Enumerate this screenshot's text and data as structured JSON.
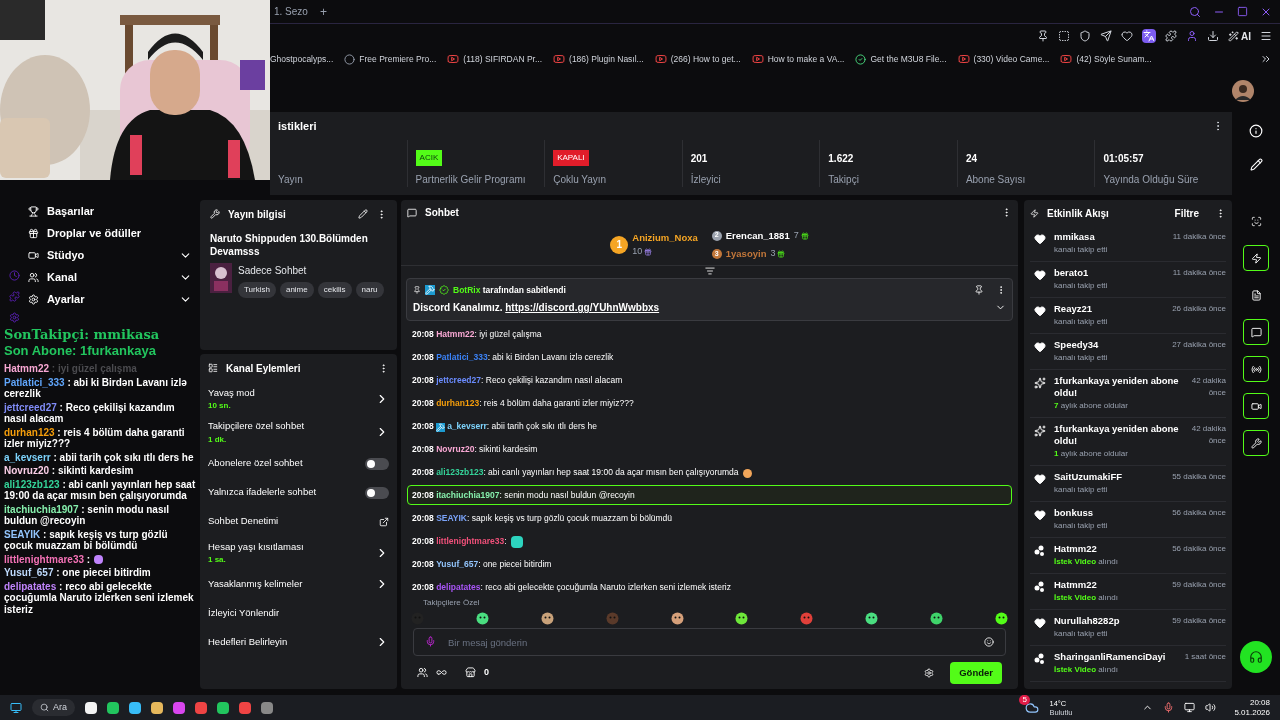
{
  "browser": {
    "tab": "1. Sezo",
    "new_tab": "+",
    "bookmarks": [
      "Ghostpocalyps...",
      "Free Premiere Pro...",
      "(118) SIFIRDAN Pr...",
      "(186) Plugin Nasıl...",
      "(266) How to get...",
      "How to make a VA...",
      "Get the M3U8 File...",
      "(330) Video Came...",
      "(42) Söyle Sunam..."
    ],
    "ai_label": "AI"
  },
  "stats": {
    "title": "istikleri",
    "cells": [
      {
        "label": "Yayın"
      },
      {
        "badge": "ACIK",
        "on": true,
        "label": "Partnerlik Gelir Programı"
      },
      {
        "badge": "KAPALI",
        "on": false,
        "label": "Çoklu Yayın"
      },
      {
        "value": "201",
        "label": "İzleyici"
      },
      {
        "value": "1.622",
        "label": "Takipçi"
      },
      {
        "value": "24",
        "label": "Abone Sayısı"
      },
      {
        "value": "01:05:57",
        "label": "Yayında Olduğu Süre"
      }
    ]
  },
  "sidebar": {
    "items": [
      {
        "label": "Başarılar"
      },
      {
        "label": "Droplar ve ödüller"
      },
      {
        "label": "Stüdyo",
        "expanded": false
      },
      {
        "label": "Kanal",
        "expanded": false
      },
      {
        "label": "Ayarlar",
        "expanded": false
      }
    ]
  },
  "overlay": {
    "last_follower": "SonTakipçi: mmikasa",
    "last_sub": "Son Abone: 1furkankaya",
    "chat": [
      {
        "kind": "text",
        "user": "Hatmm22",
        "color": "#f9a8d4",
        "text": " : iyi güzel çalışma",
        "faded": true
      },
      {
        "kind": "text",
        "user": "Patlatici_333",
        "color": "#60a5fa",
        "text": " : abi ki Birdən Lavanı izlə cerezlik",
        "faded": false
      },
      {
        "kind": "text",
        "user": "jettcreed27",
        "color": "#818cf8",
        "text": " : Reco çekilişi kazandım nasıl alacam",
        "faded": false
      },
      {
        "kind": "text",
        "user": "durhan123",
        "color": "#f59e0b",
        "text": " : reis 4 bölüm daha garanti izler miyiz???",
        "faded": false
      },
      {
        "kind": "text",
        "user": "a_kevserr",
        "color": "#7dd3fc",
        "text": " : abii tarih çok sıkı ıtlı ders he",
        "faded": false
      },
      {
        "kind": "text",
        "user": "Novruz20",
        "color": "#fbcfe8",
        "text": " : sikinti kardesim",
        "faded": false
      },
      {
        "kind": "text",
        "user": "ali123zb123",
        "color": "#34d399",
        "text": " : abi canlı yayınları hep saat 19:00 da açar mısın ben çalışıyorumda",
        "faded": false
      },
      {
        "kind": "text",
        "user": "itachiuchia1907",
        "color": "#86efac",
        "text": " : senin modu nasıl buldun @recoyin",
        "faded": false
      },
      {
        "kind": "text",
        "user": "SEAYIK",
        "color": "#93c5fd",
        "text": " : sapık keşiş vs turp gözlü çocuk muazzam bi bölümdü",
        "faded": false
      },
      {
        "kind": "emote",
        "user": "littlenightmare33",
        "color": "#f472b6",
        "text": " :",
        "faded": false
      },
      {
        "kind": "text",
        "user": "Yusuf_657",
        "color": "#bfdbfe",
        "text": " : one piecei bitirdim",
        "faded": false
      },
      {
        "kind": "text",
        "user": "delipatates",
        "color": "#c084fc",
        "text": " : reco abi gelecekte çocuğumla Naruto izlerken seni izlemek isteriz",
        "faded": false
      }
    ]
  },
  "stream_info": {
    "title": "Yayın bilgisi",
    "stream_title": "Naruto Shippuden 130.Bölümden Devamsss",
    "category": "Sadece Sohbet",
    "tags": [
      "Turkish",
      "anime",
      "cekilis",
      "naru"
    ]
  },
  "channel_actions": {
    "title": "Kanal Eylemleri",
    "items": [
      {
        "kind": "arrow",
        "label": "Yavaş mod",
        "sub": "10 sn."
      },
      {
        "kind": "arrow",
        "label": "Takipçilere özel sohbet",
        "sub": "1 dk."
      },
      {
        "kind": "toggle",
        "label": "Abonelere özel sohbet",
        "on": false
      },
      {
        "kind": "toggle",
        "label": "Yalnızca ifadelerle sohbet",
        "on": false
      },
      {
        "kind": "link",
        "label": "Sohbet Denetimi"
      },
      {
        "kind": "arrow",
        "label": "Hesap yaşı kısıtlaması",
        "sub": "1 sa."
      },
      {
        "kind": "arrow",
        "label": "Yasaklanmış kelimeler"
      },
      {
        "kind": "plain",
        "label": "İzleyici Yönlendir"
      },
      {
        "kind": "arrow",
        "label": "Hedefleri Belirleyin"
      }
    ]
  },
  "chat": {
    "title": "Sohbet",
    "gifters": [
      {
        "rank": "1",
        "name": "Anizium_Noxa",
        "count": "10"
      },
      {
        "rank": "2",
        "name": "Erencan_1881",
        "count": "7"
      },
      {
        "rank": "3",
        "name": "1yasoyin",
        "count": "3"
      }
    ],
    "pinned": {
      "by": "BotRix",
      "by_text": "tarafından sabitlendi",
      "text": "Discord Kanalımız.",
      "link": "https://discord.gg/YUhnWwbbxs"
    },
    "messages": [
      {
        "kind": "text",
        "time": "20:08",
        "user": "Hatmm22",
        "color": "#f9a8d4",
        "text": ": iyi güzel çalışma",
        "highlighted": false
      },
      {
        "kind": "text",
        "time": "20:08",
        "user": "Patlatici_333",
        "color": "#3b82f6",
        "text": ": abi ki Birdən Lavanı izlə cerezlik",
        "highlighted": false
      },
      {
        "kind": "text",
        "time": "20:08",
        "user": "jettcreed27",
        "color": "#6b8cff",
        "text": ": Reco çekilişi kazandım nasıl alacam",
        "highlighted": false
      },
      {
        "kind": "text",
        "time": "20:08",
        "user": "durhan123",
        "color": "#f59e0b",
        "text": ": reis 4 bölüm daha garanti izler miyiz???",
        "highlighted": false
      },
      {
        "kind": "text",
        "time": "20:08",
        "user": "a_kevserr",
        "color": "#7dd3fc",
        "text": ": abii tarih çok sıkı ıtlı ders he",
        "highlighted": false
      },
      {
        "kind": "text",
        "time": "20:08",
        "user": "Novruz20",
        "color": "#f9a8d4",
        "text": ": sikinti kardesim",
        "highlighted": false
      },
      {
        "kind": "text",
        "time": "20:08",
        "user": "ali123zb123",
        "color": "#34d399",
        "text": ": abi canlı yayınları hep saat 19:00 da açar mısın ben çalışıyorumda",
        "highlighted": false
      },
      {
        "kind": "text",
        "time": "20:08",
        "user": "itachiuchia1907",
        "color": "#86efac",
        "text": ": senin modu nasıl buldun @recoyin",
        "highlighted": true
      },
      {
        "kind": "text",
        "time": "20:08",
        "user": "SEAYIK",
        "color": "#7aa2f7",
        "text": ": sapık keşiş vs turp gözlü çocuk muazzam bi bölümdü",
        "highlighted": false
      },
      {
        "kind": "emote",
        "time": "20:08",
        "user": "littlenightmare33",
        "color": "#f0507a",
        "text": ":",
        "highlighted": false
      },
      {
        "kind": "text",
        "time": "20:08",
        "user": "Yusuf_657",
        "color": "#93c5fd",
        "text": ": one piecei bitirdim",
        "highlighted": false
      },
      {
        "kind": "text",
        "time": "20:08",
        "user": "delipatates",
        "color": "#a855f7",
        "text": ": reco abi gelecekte çocuğumla Naruto izlerken seni izlemek isteriz",
        "highlighted": false
      }
    ],
    "followers_only": "Takipçilere Özel",
    "placeholder": "Bir mesaj gönderin",
    "points": "0",
    "send": "Gönder"
  },
  "events": {
    "title": "Etkinlik Akışı",
    "filter": "Filtre",
    "items": [
      {
        "kind": "follow",
        "name": "mmikasa",
        "time": "11 dakika önce",
        "detail": "kanalı takip etti"
      },
      {
        "kind": "follow",
        "name": "berato1",
        "time": "11 dakika önce",
        "detail": "kanalı takip etti"
      },
      {
        "kind": "follow",
        "name": "Reayz21",
        "time": "26 dakika önce",
        "detail": "kanalı takip etti"
      },
      {
        "kind": "follow",
        "name": "Speedy34",
        "time": "27 dakika önce",
        "detail": "kanalı takip etti"
      },
      {
        "kind": "resub",
        "name": "1furkankaya yeniden abone oldu!",
        "time": "42 dakika önce",
        "highlight": "7",
        "detail": "aylık abone oldular"
      },
      {
        "kind": "resub",
        "name": "1furkankaya yeniden abone oldu!",
        "time": "42 dakika önce",
        "highlight": "1",
        "detail": "aylık abone oldular"
      },
      {
        "kind": "follow",
        "name": "SaitUzumakiFF",
        "time": "55 dakika önce",
        "detail": "kanalı takip etti"
      },
      {
        "kind": "follow",
        "name": "bonkuss",
        "time": "56 dakika önce",
        "detail": "kanalı takip etti"
      },
      {
        "kind": "redeem",
        "name": "Hatmm22",
        "time": "56 dakika önce",
        "highlight": "İstek Video",
        "detail": "alındı"
      },
      {
        "kind": "redeem",
        "name": "Hatmm22",
        "time": "59 dakika önce",
        "highlight": "İstek Video",
        "detail": "alındı"
      },
      {
        "kind": "follow",
        "name": "Nurullah8282p",
        "time": "59 dakika önce",
        "detail": "kanalı takip etti"
      },
      {
        "kind": "redeem",
        "name": "SharinganliRamenciDayi",
        "time": "1 saat önce",
        "highlight": "İstek Video",
        "detail": "alındı"
      }
    ]
  },
  "rail": [
    {
      "kind": "focus",
      "on": false
    },
    {
      "kind": "bolt",
      "on": true
    },
    {
      "kind": "notes",
      "on": false
    },
    {
      "kind": "chat",
      "on": true
    },
    {
      "kind": "broadcast",
      "on": true
    },
    {
      "kind": "camera",
      "on": true
    },
    {
      "kind": "wrench",
      "on": true
    }
  ],
  "taskbar": {
    "search": "Ara",
    "temperature": "14°C",
    "weather": "Bulutlu",
    "weather_badge": "5",
    "time": "20:08",
    "date": "5.01.2026"
  }
}
